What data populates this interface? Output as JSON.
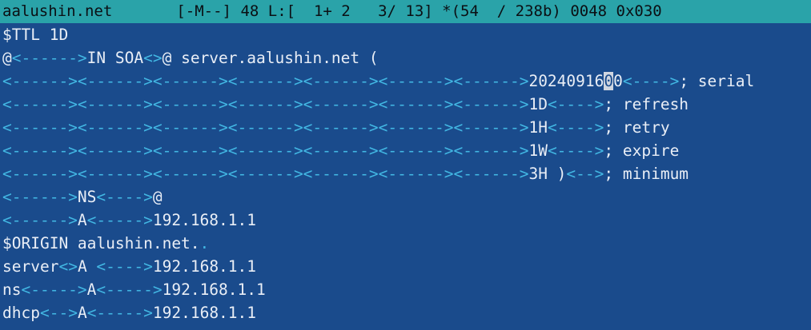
{
  "status_bar": {
    "filename": "aalushin.net",
    "flags": "[-M--]",
    "column": "48",
    "line_info": "L:[  1+ 2   3/ 13]",
    "char_info": "*(54  / 238b)",
    "char_code": "0048 0x030"
  },
  "editor": {
    "lines": [
      {
        "segments": [
          {
            "t": "text",
            "v": "$TTL 1D"
          }
        ]
      },
      {
        "segments": [
          {
            "t": "text",
            "v": "@"
          },
          {
            "t": "tab",
            "v": "<------>"
          },
          {
            "t": "text",
            "v": "IN SOA"
          },
          {
            "t": "tab",
            "v": "<>"
          },
          {
            "t": "text",
            "v": "@ server.aalushin.net ("
          }
        ]
      },
      {
        "segments": [
          {
            "t": "tab",
            "v": "<------><------><------><------><------><------><------>"
          },
          {
            "t": "text",
            "v": "20240916"
          },
          {
            "t": "cursor",
            "v": "0"
          },
          {
            "t": "text",
            "v": "0"
          },
          {
            "t": "tab",
            "v": "<---->"
          },
          {
            "t": "text",
            "v": "; serial"
          }
        ]
      },
      {
        "segments": [
          {
            "t": "tab",
            "v": "<------><------><------><------><------><------><------>"
          },
          {
            "t": "text",
            "v": "1D"
          },
          {
            "t": "tab",
            "v": "<---->"
          },
          {
            "t": "text",
            "v": "; refresh"
          }
        ]
      },
      {
        "segments": [
          {
            "t": "tab",
            "v": "<------><------><------><------><------><------><------>"
          },
          {
            "t": "text",
            "v": "1H"
          },
          {
            "t": "tab",
            "v": "<---->"
          },
          {
            "t": "text",
            "v": "; retry"
          }
        ]
      },
      {
        "segments": [
          {
            "t": "tab",
            "v": "<------><------><------><------><------><------><------>"
          },
          {
            "t": "text",
            "v": "1W"
          },
          {
            "t": "tab",
            "v": "<---->"
          },
          {
            "t": "text",
            "v": "; expire"
          }
        ]
      },
      {
        "segments": [
          {
            "t": "tab",
            "v": "<------><------><------><------><------><------><------>"
          },
          {
            "t": "text",
            "v": "3H )"
          },
          {
            "t": "tab",
            "v": "<-->"
          },
          {
            "t": "text",
            "v": "; minimum"
          }
        ]
      },
      {
        "segments": [
          {
            "t": "tab",
            "v": "<------>"
          },
          {
            "t": "text",
            "v": "NS"
          },
          {
            "t": "tab",
            "v": "<---->"
          },
          {
            "t": "text",
            "v": "@"
          }
        ]
      },
      {
        "segments": [
          {
            "t": "tab",
            "v": "<------>"
          },
          {
            "t": "text",
            "v": "A"
          },
          {
            "t": "tab",
            "v": "<----->"
          },
          {
            "t": "text",
            "v": "192.168.1.1"
          }
        ]
      },
      {
        "segments": [
          {
            "t": "text",
            "v": "$ORIGIN aalushin.net."
          },
          {
            "t": "dot",
            "v": "."
          }
        ]
      },
      {
        "segments": [
          {
            "t": "text",
            "v": "server"
          },
          {
            "t": "tab",
            "v": "<>"
          },
          {
            "t": "text",
            "v": "A "
          },
          {
            "t": "tab",
            "v": "<---->"
          },
          {
            "t": "text",
            "v": "192.168.1.1"
          }
        ]
      },
      {
        "segments": [
          {
            "t": "text",
            "v": "ns"
          },
          {
            "t": "tab",
            "v": "<----->"
          },
          {
            "t": "text",
            "v": "A"
          },
          {
            "t": "tab",
            "v": "<----->"
          },
          {
            "t": "text",
            "v": "192.168.1.1"
          }
        ]
      },
      {
        "segments": [
          {
            "t": "text",
            "v": "dhcp"
          },
          {
            "t": "tab",
            "v": "<-->"
          },
          {
            "t": "text",
            "v": "A"
          },
          {
            "t": "tab",
            "v": "<----->"
          },
          {
            "t": "text",
            "v": "192.168.1.1"
          }
        ]
      }
    ]
  },
  "colors": {
    "background": "#1a4b8c",
    "status_bar": "#2aa3a9",
    "text": "#e9eef6",
    "tab_marker": "#42b7e3",
    "cursor": "#d0d6e0"
  }
}
